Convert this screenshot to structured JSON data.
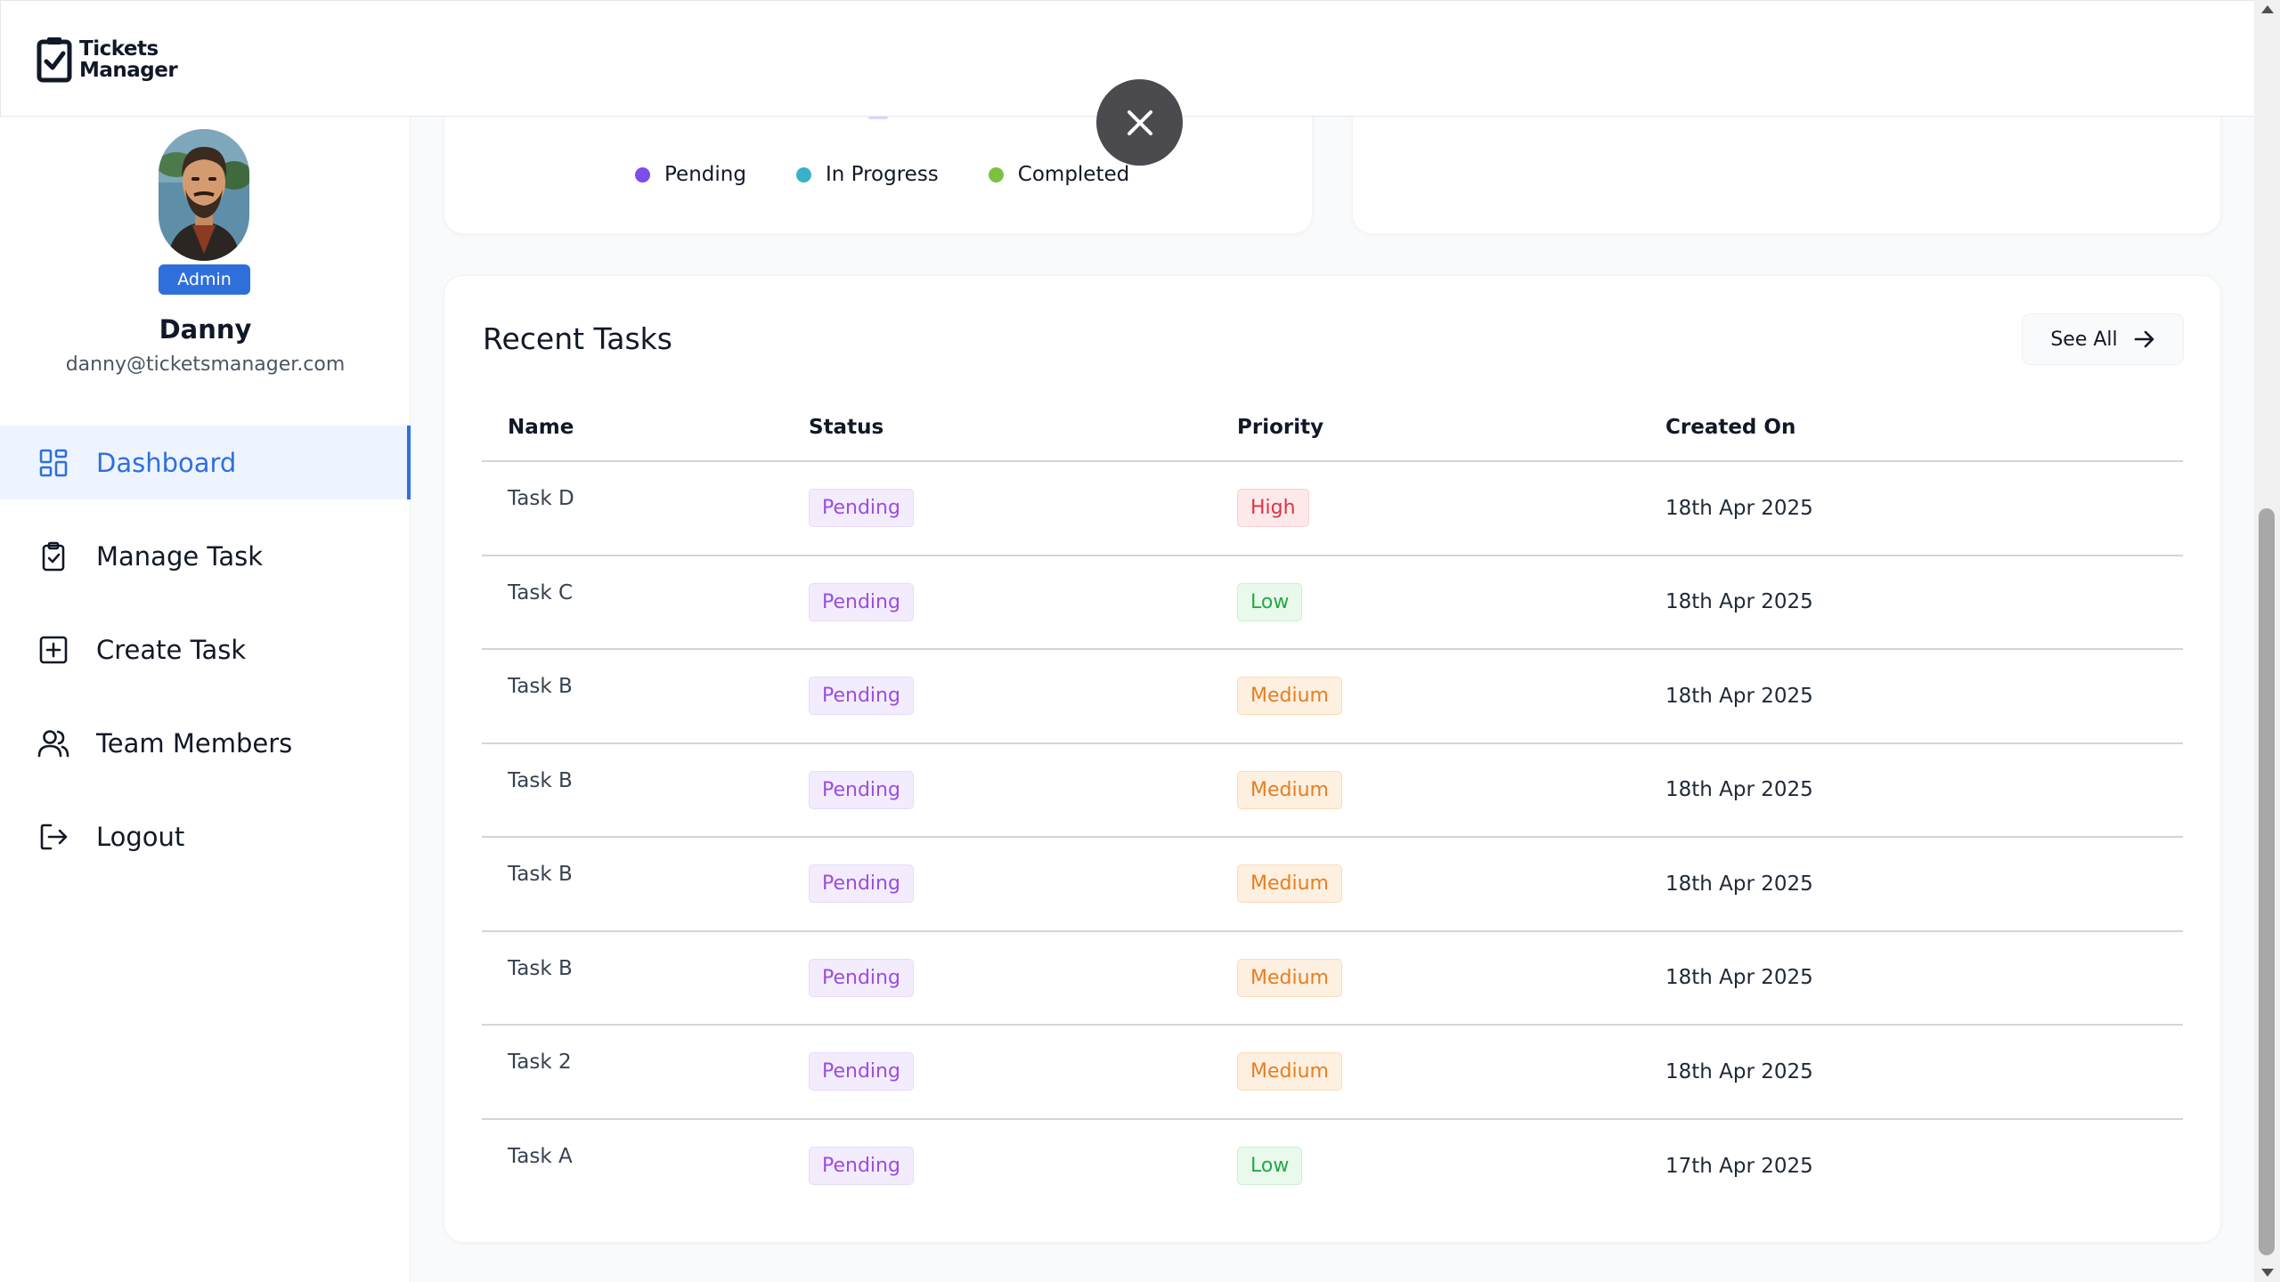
{
  "app": {
    "logo_line1": "Tickets",
    "logo_line2": "Manager"
  },
  "user": {
    "role": "Admin",
    "name": "Danny",
    "email": "danny@ticketsmanager.com"
  },
  "sidebar": {
    "items": [
      {
        "label": "Dashboard",
        "icon": "dashboard-grid-icon",
        "active": true
      },
      {
        "label": "Manage Task",
        "icon": "clipboard-check-icon",
        "active": false
      },
      {
        "label": "Create Task",
        "icon": "plus-square-icon",
        "active": false
      },
      {
        "label": "Team Members",
        "icon": "users-icon",
        "active": false
      },
      {
        "label": "Logout",
        "icon": "logout-icon",
        "active": false
      }
    ]
  },
  "chart_card": {
    "legend": [
      {
        "label": "Pending",
        "color": "#7c4dea"
      },
      {
        "label": "In Progress",
        "color": "#3bb0c9"
      },
      {
        "label": "Completed",
        "color": "#7cc242"
      }
    ]
  },
  "recent_tasks": {
    "title": "Recent Tasks",
    "see_all_label": "See All",
    "columns": [
      "Name",
      "Status",
      "Priority",
      "Created On"
    ],
    "rows": [
      {
        "name": "Task D",
        "status": "Pending",
        "priority": "High",
        "created": "18th Apr 2025"
      },
      {
        "name": "Task C",
        "status": "Pending",
        "priority": "Low",
        "created": "18th Apr 2025"
      },
      {
        "name": "Task B",
        "status": "Pending",
        "priority": "Medium",
        "created": "18th Apr 2025"
      },
      {
        "name": "Task B",
        "status": "Pending",
        "priority": "Medium",
        "created": "18th Apr 2025"
      },
      {
        "name": "Task B",
        "status": "Pending",
        "priority": "Medium",
        "created": "18th Apr 2025"
      },
      {
        "name": "Task B",
        "status": "Pending",
        "priority": "Medium",
        "created": "18th Apr 2025"
      },
      {
        "name": "Task 2",
        "status": "Pending",
        "priority": "Medium",
        "created": "18th Apr 2025"
      },
      {
        "name": "Task A",
        "status": "Pending",
        "priority": "Low",
        "created": "17th Apr 2025"
      }
    ]
  },
  "colors": {
    "accent": "#2f6fdc",
    "active_bg": "#eef4ff"
  }
}
